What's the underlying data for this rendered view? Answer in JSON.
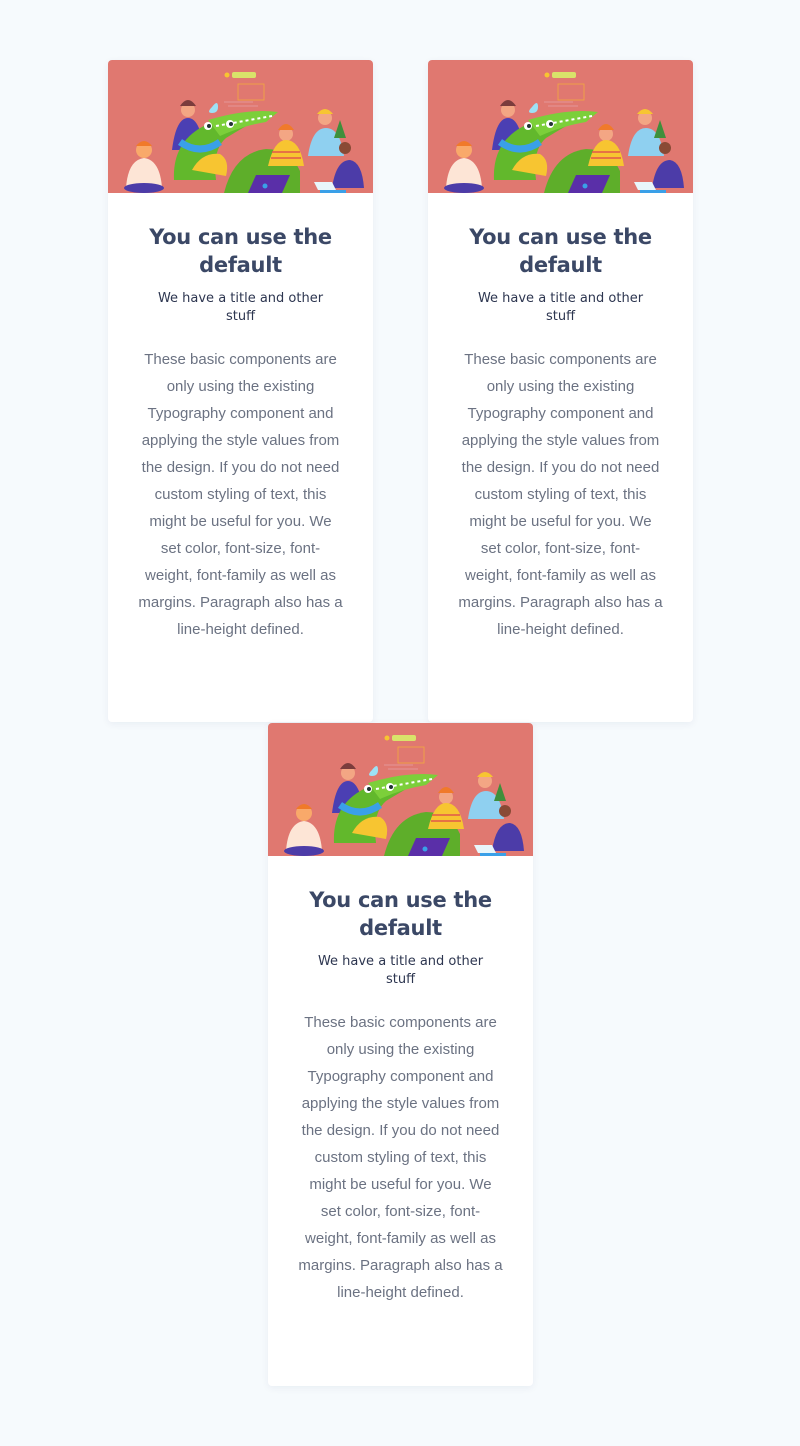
{
  "colors": {
    "background": "#f6fafd",
    "card": "#ffffff",
    "illustration_bg": "#e07870",
    "title": "#3b4866",
    "subtitle": "#2d3650",
    "body": "#6b7282"
  },
  "cards": [
    {
      "image": "team-with-crocodile-illustration",
      "title": "You can use the default",
      "subtitle": "We have a title and other stuff",
      "text": "These basic components are only using the existing Typography component and applying the style values from the design. If you do not need custom styling of text, this might be useful for you. We set color, font-size, font-weight, font-family as well as margins. Paragraph also has a line-height defined."
    },
    {
      "image": "team-with-crocodile-illustration",
      "title": "You can use the default",
      "subtitle": "We have a title and other stuff",
      "text": "These basic components are only using the existing Typography component and applying the style values from the design. If you do not need custom styling of text, this might be useful for you. We set color, font-size, font-weight, font-family as well as margins. Paragraph also has a line-height defined."
    },
    {
      "image": "team-with-crocodile-illustration",
      "title": "You can use the default",
      "subtitle": "We have a title and other stuff",
      "text": "These basic components are only using the existing Typography component and applying the style values from the design. If you do not need custom styling of text, this might be useful for you. We set color, font-size, font-weight, font-family as well as margins. Paragraph also has a line-height defined."
    }
  ]
}
